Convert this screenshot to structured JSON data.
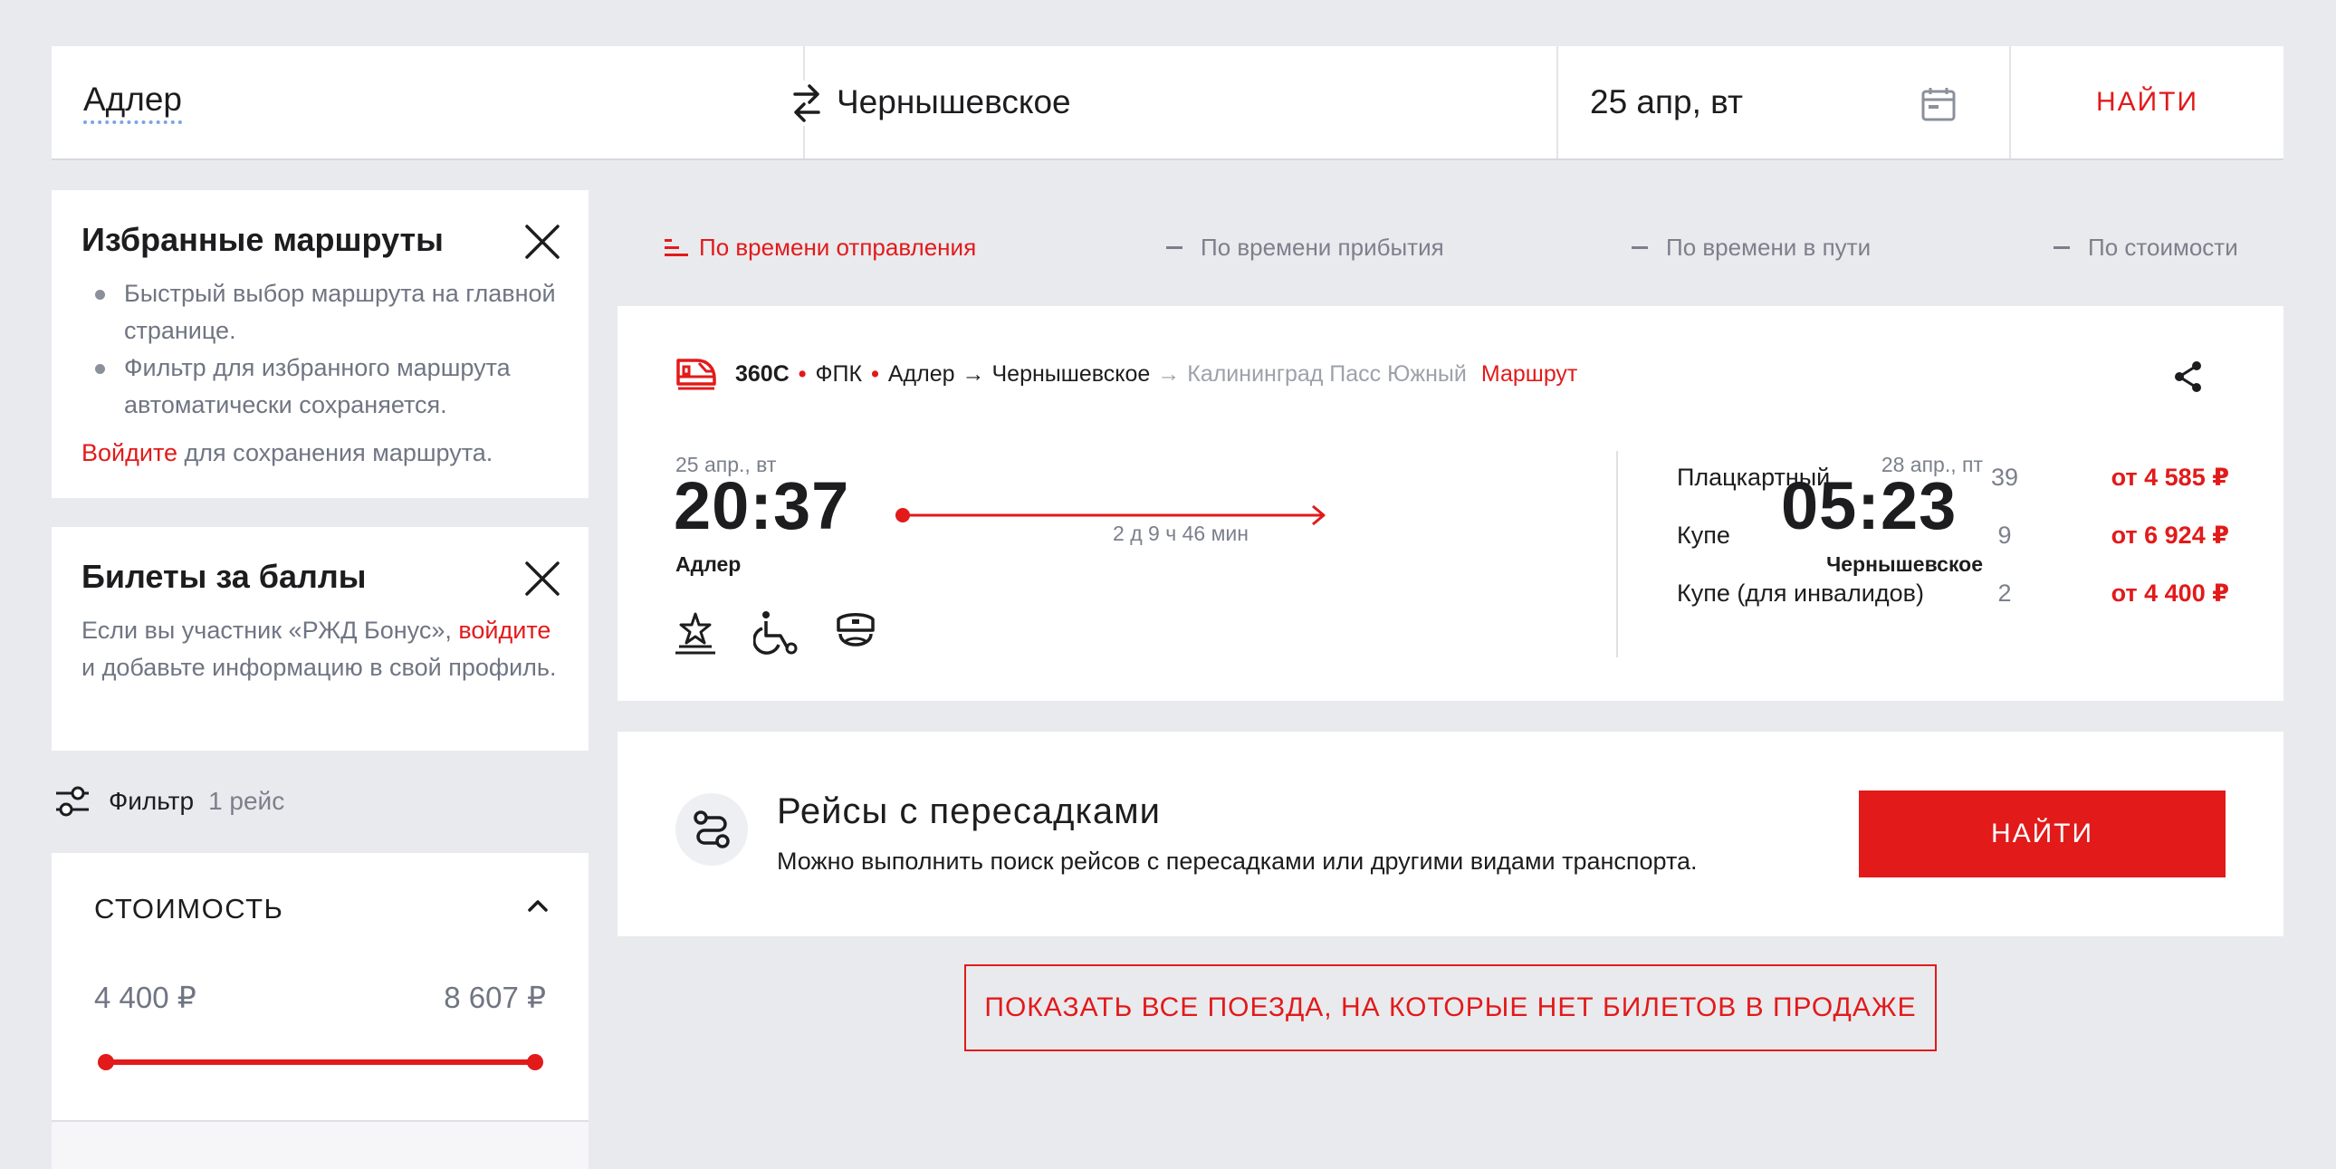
{
  "search": {
    "from": "Адлер",
    "to": "Чернышевское",
    "date": "25 апр, вт",
    "find_label": "НАЙТИ"
  },
  "favorites": {
    "title": "Избранные маршруты",
    "items": [
      "Быстрый выбор маршрута на главной странице.",
      "Фильтр для избранного маршрута автоматически сохраняется."
    ],
    "login_link": "Войдите",
    "login_text": " для сохранения маршрута."
  },
  "bonus": {
    "title": "Билеты за баллы",
    "text_before": "Если вы участник «РЖД Бонус», ",
    "login_link": "войдите",
    "text_after": " и добавьте информацию в свой профиль."
  },
  "filter": {
    "label": "Фильтр",
    "count": "1 рейс"
  },
  "price_filter": {
    "title": "СТОИМОСТЬ",
    "min": "4 400 ₽",
    "max": "8 607 ₽"
  },
  "sort": {
    "items": [
      {
        "label": "По времени отправления",
        "active": true
      },
      {
        "label": "По времени прибытия",
        "active": false
      },
      {
        "label": "По времени в пути",
        "active": false
      },
      {
        "label": "По стоимости",
        "active": false
      }
    ]
  },
  "train": {
    "number": "360С",
    "carrier": "ФПК",
    "from": "Адлер",
    "to": "Чернышевское",
    "final": "Калининград Пасс Южный",
    "route_link": "Маршрут",
    "departure": {
      "date": "25 апр., вт",
      "time": "20:37",
      "station": "Адлер"
    },
    "arrival": {
      "date": "28 апр., пт",
      "time": "05:23",
      "station": "Чернышевское"
    },
    "duration": "2 д 9 ч 46 мин",
    "amenities": [
      "star-podium-icon",
      "wheelchair-icon",
      "conductor-cap-icon"
    ],
    "seats": [
      {
        "class": "Плацкартный",
        "count": "39",
        "price": "от 4 585 ₽"
      },
      {
        "class": "Купе",
        "count": "9",
        "price": "от 6 924 ₽"
      },
      {
        "class": "Купе (для инвалидов)",
        "count": "2",
        "price": "от 4 400 ₽"
      }
    ]
  },
  "transfers": {
    "title": "Рейсы с пересадками",
    "description": "Можно выполнить поиск рейсов с пересадками или другими видами транспорта.",
    "button": "НАЙТИ"
  },
  "show_all": "ПОКАЗАТЬ ВСЕ ПОЕЗДА, НА КОТОРЫЕ НЕТ БИЛЕТОВ В ПРОДАЖЕ",
  "colors": {
    "accent": "#e21a1a",
    "background": "#e9eaee",
    "muted": "#7b808b"
  }
}
